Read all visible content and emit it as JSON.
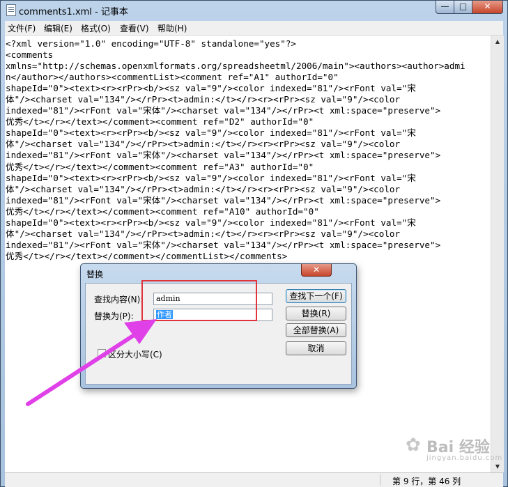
{
  "window": {
    "title": "comments1.xml - 记事本"
  },
  "menu": [
    "文件(F)",
    "编辑(E)",
    "格式(O)",
    "查看(V)",
    "帮助(H)"
  ],
  "editor": {
    "lines": [
      "<?xml version=\"1.0\" encoding=\"UTF-8\" standalone=\"yes\"?>",
      "<comments",
      "xmlns=\"http://schemas.openxmlformats.org/spreadsheetml/2006/main\"><authors><author>admi",
      "n</author></authors><commentList><comment ref=\"A1\" authorId=\"0\"",
      "shapeId=\"0\"><text><r><rPr><b/><sz val=\"9\"/><color indexed=\"81\"/><rFont val=\"宋",
      "体\"/><charset val=\"134\"/></rPr><t>admin:</t></r><r><rPr><sz val=\"9\"/><color",
      "indexed=\"81\"/><rFont val=\"宋体\"/><charset val=\"134\"/></rPr><t xml:space=\"preserve\">",
      "优秀</t></r></text></comment><comment ref=\"D2\" authorId=\"0\"",
      "shapeId=\"0\"><text><r><rPr><b/><sz val=\"9\"/><color indexed=\"81\"/><rFont val=\"宋",
      "体\"/><charset val=\"134\"/></rPr><t>admin:</t></r><r><rPr><sz val=\"9\"/><color",
      "indexed=\"81\"/><rFont val=\"宋体\"/><charset val=\"134\"/></rPr><t xml:space=\"preserve\">",
      "优秀</t></r></text></comment><comment ref=\"A3\" authorId=\"0\"",
      "shapeId=\"0\"><text><r><rPr><b/><sz val=\"9\"/><color indexed=\"81\"/><rFont val=\"宋",
      "体\"/><charset val=\"134\"/></rPr><t>admin:</t></r><r><rPr><sz val=\"9\"/><color",
      "indexed=\"81\"/><rFont val=\"宋体\"/><charset val=\"134\"/></rPr><t xml:space=\"preserve\">",
      "优秀</t></r></text></comment><comment ref=\"A10\" authorId=\"0\"",
      "shapeId=\"0\"><text><r><rPr><b/><sz val=\"9\"/><color indexed=\"81\"/><rFont val=\"宋",
      "体\"/><charset val=\"134\"/></rPr><t>admin:</t></r><r><rPr><sz val=\"9\"/><color",
      "indexed=\"81\"/><rFont val=\"宋体\"/><charset val=\"134\"/></rPr><t xml:space=\"preserve\">",
      "优秀</t></r></text></comment></commentList></comments>"
    ]
  },
  "status": {
    "position": "第 9 行，第 46 列"
  },
  "dialog": {
    "title": "替换",
    "find_label": "查找内容(N):",
    "find_value": "admin",
    "replace_label": "替换为(P):",
    "replace_value": "作者",
    "buttons": {
      "find_next": "查找下一个(F)",
      "replace": "替换(R)",
      "replace_all": "全部替换(A)",
      "cancel": "取消"
    },
    "match_case_label": "区分大小写(C)",
    "match_case_checked": false
  },
  "annotation": {
    "highlight_color": "#e0333a",
    "arrow_color": "#e040e8"
  },
  "watermark": {
    "main": "Bai 经验",
    "sub": "jingyan.baidu.com"
  }
}
